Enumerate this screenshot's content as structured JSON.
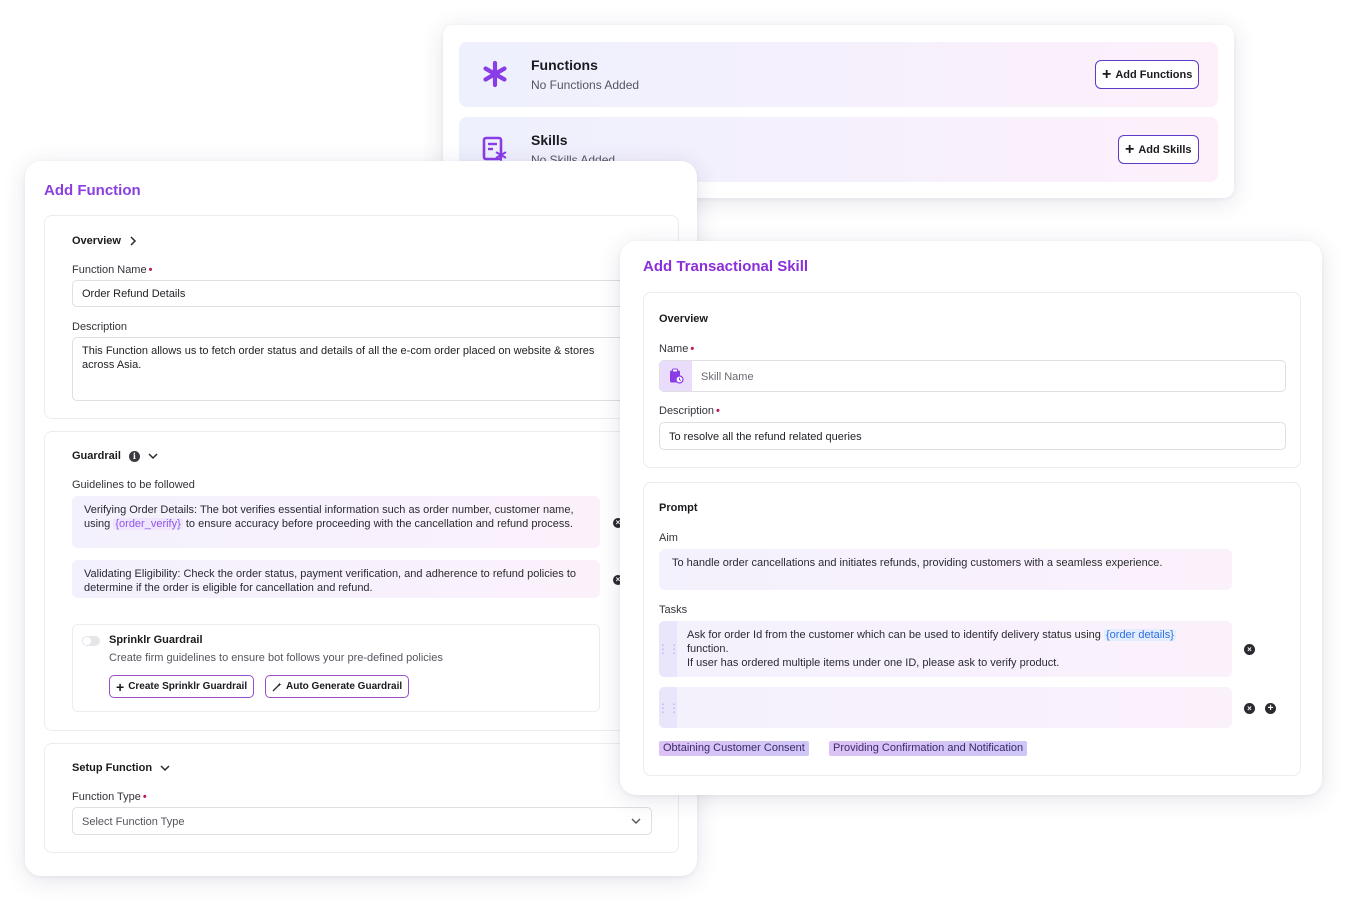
{
  "top_card": {
    "functions": {
      "title": "Functions",
      "subtitle": "No Functions Added",
      "button": "Add Functions",
      "icon": "asterisk-icon"
    },
    "skills": {
      "title": "Skills",
      "subtitle": "No Skills Added",
      "button": "Add Skills",
      "icon": "skill-document-icon"
    }
  },
  "add_function": {
    "title": "Add Function",
    "overview": {
      "heading": "Overview",
      "function_name_label": "Function Name",
      "function_name_value": "Order Refund Details",
      "description_label": "Description",
      "description_value": "This Function allows us to fetch order status and details of all the e-com order placed on website & stores across Asia."
    },
    "guardrail": {
      "heading": "Guardrail",
      "guidelines_label": "Guidelines to be followed",
      "guideline1_pre": "Verifying Order Details: The bot verifies essential information such as order number, customer name, using ",
      "guideline1_var": "{order_verify}",
      "guideline1_post": " to ensure accuracy before proceeding with the cancellation and refund process.",
      "guideline2": "Validating Eligibility: Check the order status, payment verification, and adherence to refund policies to determine if the order is eligible for cancellation and refund.",
      "sprinklr_title": "Sprinklr Guardrail",
      "sprinklr_desc": "Create firm guidelines to ensure bot follows your pre-defined policies",
      "create_button": "Create Sprinklr Guardrail",
      "auto_button": "Auto Generate Guardrail"
    },
    "setup": {
      "heading": "Setup Function",
      "type_label": "Function Type",
      "type_placeholder": "Select Function Type"
    }
  },
  "add_skill": {
    "title": "Add Transactional Skill",
    "overview": {
      "heading": "Overview",
      "name_label": "Name",
      "name_placeholder": "Skill Name",
      "description_label": "Description",
      "description_value": "To resolve all the refund related queries"
    },
    "prompt": {
      "heading": "Prompt",
      "aim_label": "Aim",
      "aim_value": "To handle order cancellations and initiates refunds, providing customers with a seamless experience.",
      "tasks_label": "Tasks",
      "task1_pre": "Ask for order Id from the customer which can be used to identify delivery status using ",
      "task1_var": "{order details}",
      "task1_post": " function.",
      "task1_line2": "If user has ordered multiple items under one ID, please ask to verify product.",
      "pills": [
        "Obtaining Customer Consent",
        "Providing Confirmation and Notification"
      ]
    }
  },
  "colors": {
    "accent": "#8b3fe0",
    "button_border": "#5a3cc8",
    "required": "#c21b63"
  }
}
